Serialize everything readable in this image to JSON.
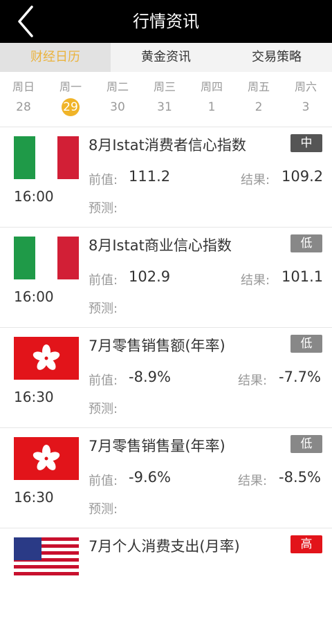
{
  "header": {
    "title": "行情资讯",
    "back_icon": "chevron-left-icon"
  },
  "tabs": [
    {
      "label": "财经日历",
      "active": true
    },
    {
      "label": "黄金资讯",
      "active": false
    },
    {
      "label": "交易策略",
      "active": false
    }
  ],
  "week": [
    {
      "name": "周日",
      "date": "28",
      "selected": false
    },
    {
      "name": "周一",
      "date": "29",
      "selected": true
    },
    {
      "name": "周二",
      "date": "30",
      "selected": false
    },
    {
      "name": "周三",
      "date": "31",
      "selected": false
    },
    {
      "name": "周四",
      "date": "1",
      "selected": false
    },
    {
      "name": "周五",
      "date": "2",
      "selected": false
    },
    {
      "name": "周六",
      "date": "3",
      "selected": false
    }
  ],
  "labels": {
    "previous": "前值:",
    "result": "结果:",
    "forecast": "预测:"
  },
  "colors": {
    "accent": "#f0b428",
    "importance_mid": "#555555",
    "importance_low": "#888888",
    "importance_high": "#e2141a"
  },
  "events": [
    {
      "flag": "italy-flag",
      "time": "16:00",
      "name": "8月Istat消费者信心指数",
      "importance": "中",
      "previous": "111.2",
      "result": "109.2",
      "forecast": ""
    },
    {
      "flag": "italy-flag",
      "time": "16:00",
      "name": "8月Istat商业信心指数",
      "importance": "低",
      "previous": "102.9",
      "result": "101.1",
      "forecast": ""
    },
    {
      "flag": "hong-kong-flag",
      "time": "16:30",
      "name": "7月零售销售额(年率)",
      "importance": "低",
      "previous": "-8.9%",
      "result": "-7.7%",
      "forecast": ""
    },
    {
      "flag": "hong-kong-flag",
      "time": "16:30",
      "name": "7月零售销售量(年率)",
      "importance": "低",
      "previous": "-9.6%",
      "result": "-8.5%",
      "forecast": ""
    },
    {
      "flag": "usa-flag",
      "time": "",
      "name": "7月个人消费支出(月率)",
      "importance": "高",
      "previous": "",
      "result": "",
      "forecast": ""
    }
  ]
}
